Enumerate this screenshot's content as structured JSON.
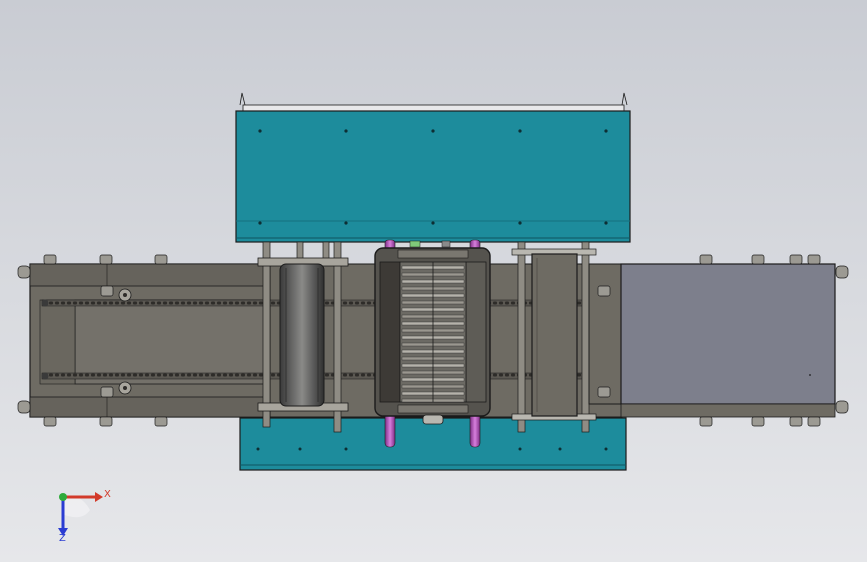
{
  "viewport": {
    "background_top": "#c9ccd3",
    "background_bottom": "#e6e7ea"
  },
  "colors": {
    "teal_panel": "#1d8c9c",
    "teal_dark": "#15707e",
    "conveyor_grey": "#6e6b63",
    "conveyor_dark": "#4f4c46",
    "cover_plate": "#7d7f8c",
    "chain": "#3a3a3a",
    "magenta_tube": "#b04fb6",
    "outline": "#1b1b1b"
  },
  "triad": {
    "x_label": "X",
    "z_label": "Z",
    "x_color": "#d23a2a",
    "y_color": "#2eab3a",
    "z_color": "#2a3cd2"
  }
}
